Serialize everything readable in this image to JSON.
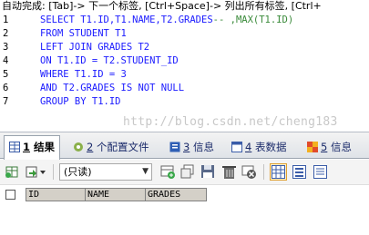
{
  "hint": "自动完成: [Tab]-> 下一个标签, [Ctrl+Space]-> 列出所有标签, [Ctrl+",
  "editor": {
    "lines": [
      {
        "num": "1",
        "parts": [
          {
            "t": "kw",
            "v": "SELECT T1.ID,T1.NAME,T2.GRADES"
          },
          {
            "t": "cm",
            "v": "-- ,MAX(T1.ID)"
          }
        ]
      },
      {
        "num": "2",
        "parts": [
          {
            "t": "kw",
            "v": "FROM STUDENT T1"
          }
        ]
      },
      {
        "num": "3",
        "parts": [
          {
            "t": "kw",
            "v": "LEFT JOIN GRADES T2"
          }
        ]
      },
      {
        "num": "4",
        "parts": [
          {
            "t": "kw",
            "v": "ON T1.ID = T2.STUDENT_ID"
          }
        ]
      },
      {
        "num": "5",
        "parts": [
          {
            "t": "kw",
            "v": "WHERE T1.ID = 3"
          }
        ]
      },
      {
        "num": "6",
        "parts": [
          {
            "t": "kw",
            "v": "AND T2.GRADES IS NOT NULL"
          }
        ]
      },
      {
        "num": "7",
        "parts": [
          {
            "t": "kw",
            "v": "GROUP BY T1.ID"
          }
        ]
      }
    ],
    "watermark": "http://blog.csdn.net/cheng183"
  },
  "tabs": [
    {
      "num": "1",
      "label": "结果",
      "active": true
    },
    {
      "num": "2",
      "label": "个配置文件",
      "active": false
    },
    {
      "num": "3",
      "label": "信息",
      "active": false
    },
    {
      "num": "4",
      "label": "表数据",
      "active": false
    },
    {
      "num": "5",
      "label": "信息",
      "active": false
    }
  ],
  "toolbar": {
    "mode_select": "(只读)"
  },
  "grid": {
    "columns": [
      "ID",
      "NAME",
      "GRADES"
    ]
  },
  "colors": {
    "keyword": "#1a1aff",
    "comment": "#3a8a3a",
    "watermark": "#c8c8c8",
    "header": "#d4d0c8"
  }
}
